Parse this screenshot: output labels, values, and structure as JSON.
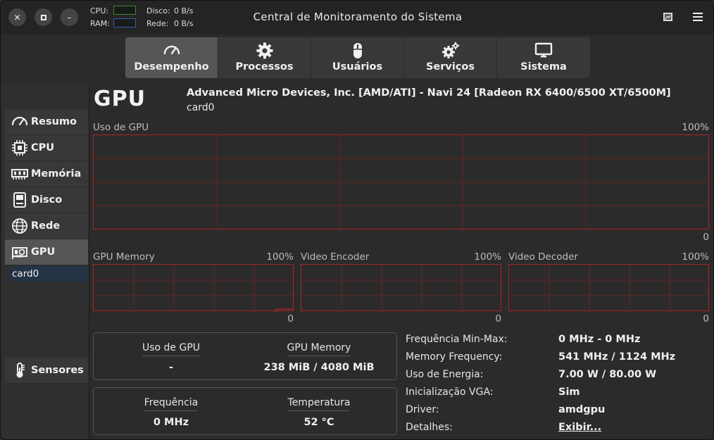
{
  "window": {
    "title": "Central de Monitoramento do Sistema",
    "controls": {
      "close": "✕",
      "maximize": "▢",
      "minimize": "–"
    }
  },
  "mini_monitors": {
    "cpu_label": "CPU:",
    "ram_label": "RAM:",
    "disk_label": "Disco:",
    "disk_value": "0 B/s",
    "net_label": "Rede:",
    "net_value": "0 B/s",
    "cpu_color": "#3b8a2e",
    "ram_color": "#2f5ea8"
  },
  "tabs": [
    {
      "label": "Desempenho",
      "icon": "gauge-icon",
      "active": true
    },
    {
      "label": "Processos",
      "icon": "gear-icon",
      "active": false
    },
    {
      "label": "Usuários",
      "icon": "mouse-icon",
      "active": false
    },
    {
      "label": "Serviços",
      "icon": "gears-icon",
      "active": false
    },
    {
      "label": "Sistema",
      "icon": "monitor-icon",
      "active": false
    }
  ],
  "sidebar": {
    "items": [
      {
        "label": "Resumo",
        "icon": "gauge-icon"
      },
      {
        "label": "CPU",
        "icon": "cpu-icon"
      },
      {
        "label": "Memória",
        "icon": "memory-icon"
      },
      {
        "label": "Disco",
        "icon": "disk-icon"
      },
      {
        "label": "Rede",
        "icon": "globe-icon"
      },
      {
        "label": "GPU",
        "icon": "gpu-icon",
        "active": true
      }
    ],
    "sub_item": "card0",
    "sensors": {
      "label": "Sensores",
      "icon": "thermometer-icon"
    }
  },
  "main": {
    "heading": "GPU",
    "model": "Advanced Micro Devices, Inc. [AMD/ATI] - Navi 24 [Radeon RX 6400/6500 XT/6500M]",
    "device": "card0",
    "graphs": {
      "gpu_usage": {
        "label": "Uso de GPU",
        "max": "100%",
        "min": "0"
      },
      "gpu_memory": {
        "label": "GPU Memory",
        "max": "100%",
        "min": "0",
        "fill_fraction": 0.058
      },
      "video_encoder": {
        "label": "Video Encoder",
        "max": "100%",
        "min": "0"
      },
      "video_decoder": {
        "label": "Video Decoder",
        "max": "100%",
        "min": "0"
      },
      "line_color": "#a72526"
    },
    "stats": {
      "gpu_usage_title": "Uso de GPU",
      "gpu_usage_value": "-",
      "gpu_memory_title": "GPU Memory",
      "gpu_memory_value": "238 MiB / 4080 MiB",
      "frequency_title": "Frequência",
      "frequency_value": "0 MHz",
      "temperature_title": "Temperatura",
      "temperature_value": "52 °C"
    },
    "info": [
      {
        "key": "Frequência Min-Max:",
        "value": "0 MHz - 0 MHz"
      },
      {
        "key": "Memory Frequency:",
        "value": "541 MHz / 1124 MHz"
      },
      {
        "key": "Uso de Energia:",
        "value": "7.00 W / 80.00 W"
      },
      {
        "key": "Inicialização VGA:",
        "value": "Sim"
      },
      {
        "key": "Driver:",
        "value": "amdgpu"
      },
      {
        "key": "Detalhes:",
        "value": "Exibir..."
      }
    ]
  }
}
